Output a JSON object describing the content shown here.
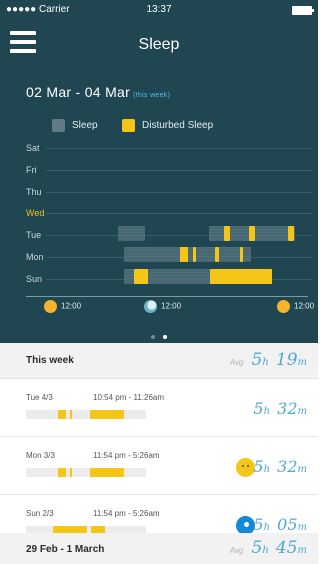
{
  "status": {
    "carrier": "●●●●● Carrier",
    "time": "13:37"
  },
  "header": {
    "title": "Sleep"
  },
  "range": {
    "dates": "02 Mar - 04 Mar",
    "week_tag": "(this week)"
  },
  "legend": {
    "sleep": "Sleep",
    "disturbed": "Disturbed Sleep"
  },
  "days": [
    "Sat",
    "Fri",
    "Thu",
    "Wed",
    "Tue",
    "Mon",
    "Sun"
  ],
  "axis": [
    "12:00",
    "12:00",
    "12:00"
  ],
  "colors": {
    "header_bg": "#1f4651",
    "sleep": "#4f6f79",
    "disturbed": "#f5c518",
    "current_day": "#f0c020",
    "accent": "#4da9d5"
  },
  "week": {
    "label": "This week",
    "avg_label": "Avg",
    "avg_h": "5",
    "avg_h_unit": "h",
    "avg_m": "19",
    "avg_m_unit": "m"
  },
  "entries": [
    {
      "day": "Tue 4/3",
      "span": "10:54 pm - 11:26am",
      "h": "5",
      "hu": "h",
      "m": "32",
      "mu": "m",
      "mood": ""
    },
    {
      "day": "Mon 3/3",
      "span": "11:54 pm - 5:26am",
      "h": "5",
      "hu": "h",
      "m": "32",
      "mu": "m",
      "mood": "happy-face-icon"
    },
    {
      "day": "Sun 2/3",
      "span": "11:54 pm - 5:26am",
      "h": "5",
      "hu": "h",
      "m": "05",
      "mu": "m",
      "mood": "blue-mood-icon"
    }
  ],
  "prev_week": {
    "label": "29 Feb - 1 March",
    "avg_label": "Avg",
    "avg_h": "5",
    "avg_h_unit": "h",
    "avg_m": "45",
    "avg_m_unit": "m"
  }
}
